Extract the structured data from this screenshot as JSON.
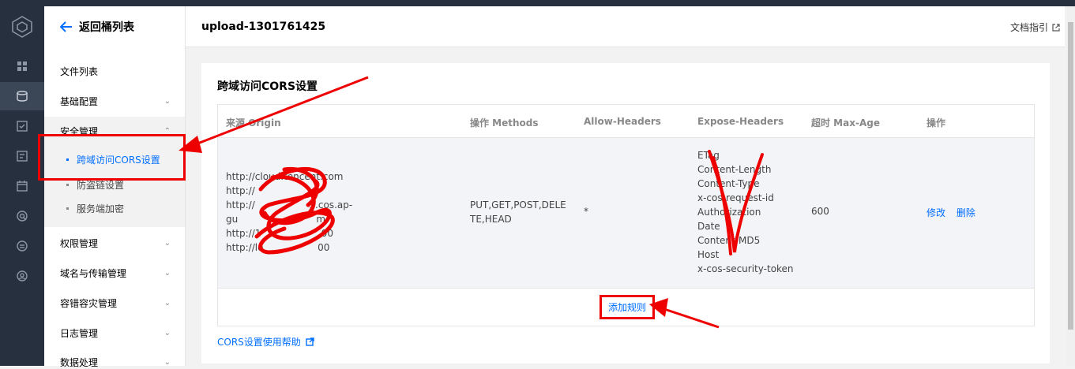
{
  "iconbar": {
    "logo": "cube-logo-icon",
    "items": [
      "grid-icon",
      "bucket-icon",
      "checklist-icon",
      "task-icon",
      "calendar-icon",
      "gear-search-icon",
      "circle-lines-icon",
      "circle-user-icon"
    ]
  },
  "sidebar": {
    "back_label": "返回桶列表",
    "items": [
      {
        "label": "文件列表",
        "chevron": false
      },
      {
        "label": "基础配置",
        "chevron": true
      },
      {
        "label": "安全管理",
        "chevron": true
      },
      {
        "label": "权限管理",
        "chevron": true
      },
      {
        "label": "域名与传输管理",
        "chevron": true
      },
      {
        "label": "容错容灾管理",
        "chevron": true
      },
      {
        "label": "日志管理",
        "chevron": true
      },
      {
        "label": "数据处理",
        "chevron": true
      }
    ],
    "security_sub": [
      {
        "label": "跨域访问CORS设置",
        "active": true
      },
      {
        "label": "防盗链设置",
        "active": false
      },
      {
        "label": "服务端加密",
        "active": false
      }
    ]
  },
  "header": {
    "bucket_title": "upload-1301761425",
    "doc_link": "文档指引"
  },
  "card": {
    "title": "跨域访问CORS设置",
    "columns": [
      "来源 Origin",
      "操作 Methods",
      "Allow-Headers",
      "Expose-Headers",
      "超时 Max-Age",
      "操作"
    ],
    "row": {
      "origins": [
        "http://cloud.tencent.com",
        "http://",
        "http://                  5.cos.ap-",
        "gu                          m",
        "http://1                    00",
        "http://lo                  00"
      ],
      "methods_line1": "PUT,GET,POST,DELE",
      "methods_line2": "TE,HEAD",
      "allow_headers": "*",
      "expose_headers": [
        "ETag",
        "Content-Length",
        "Content-Type",
        "x-cos-request-id",
        "Authorization",
        "Date",
        "Content-MD5",
        "Host",
        "x-cos-security-token"
      ],
      "max_age": "600",
      "action_edit": "修改",
      "action_delete": "删除"
    },
    "add_rule": "添加规则",
    "help_link": "CORS设置使用帮助"
  },
  "colors": {
    "accent": "#006eff",
    "nav_dark": "#26303f",
    "annotation": "#e00000"
  }
}
